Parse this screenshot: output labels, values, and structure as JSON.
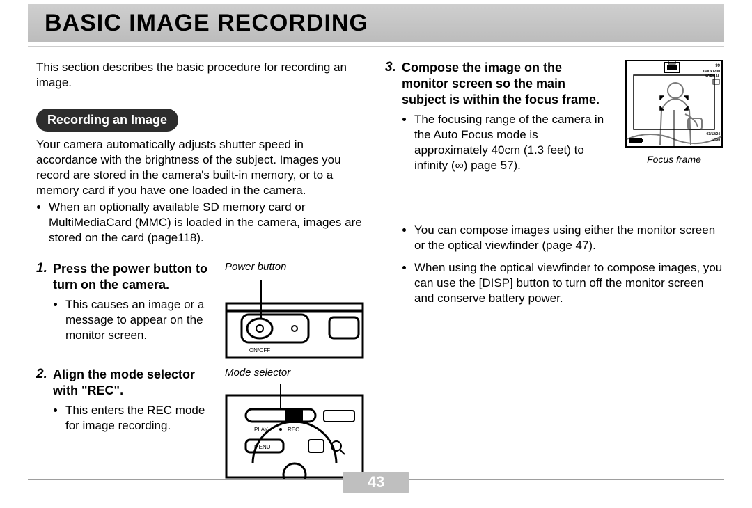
{
  "title": "BASIC IMAGE RECORDING",
  "intro": "This section describes the basic procedure for recording an image.",
  "section_heading": "Recording an Image",
  "overview": "Your camera automatically adjusts shutter speed in accordance with the brightness of the subject. Images you record are stored in the camera's built-in memory, or to a memory card if you have one loaded in the camera.",
  "overview_bullet": "When an optionally available SD memory card or MultiMediaCard (MMC) is loaded in the camera, images are stored on the card (page118).",
  "steps": {
    "s1": {
      "num": "1.",
      "title": "Press the power button to turn on the camera.",
      "bullet": "This causes an image or a message to appear on the monitor screen.",
      "fig_label": "Power button",
      "onoff": "ON/OFF"
    },
    "s2": {
      "num": "2.",
      "title": "Align the mode selector with \"REC\".",
      "bullet": "This enters the REC mode for image recording.",
      "fig_label": "Mode selector",
      "play": "PLAY",
      "rec": "REC",
      "menu": "MENU"
    },
    "s3": {
      "num": "3.",
      "title": "Compose the image on the monitor screen so the main subject is within the focus frame.",
      "b1": "The focusing range of the camera in the Auto Focus mode is approximately 40cm (1.3 feet) to infinity (∞) page 57).",
      "b2": "You can compose images using either the monitor screen or the optical viewfinder (page 47).",
      "b3": "When using the optical viewfinder to compose images, you can use the [DISP] button to turn off the monitor screen and conserve battery power.",
      "monitor_caption": "Focus frame",
      "osd": {
        "count": "99",
        "res": "1600×1200",
        "quality": "NORMAL",
        "date": "03/12/24",
        "time": "12:58"
      }
    }
  },
  "page_number": "43"
}
